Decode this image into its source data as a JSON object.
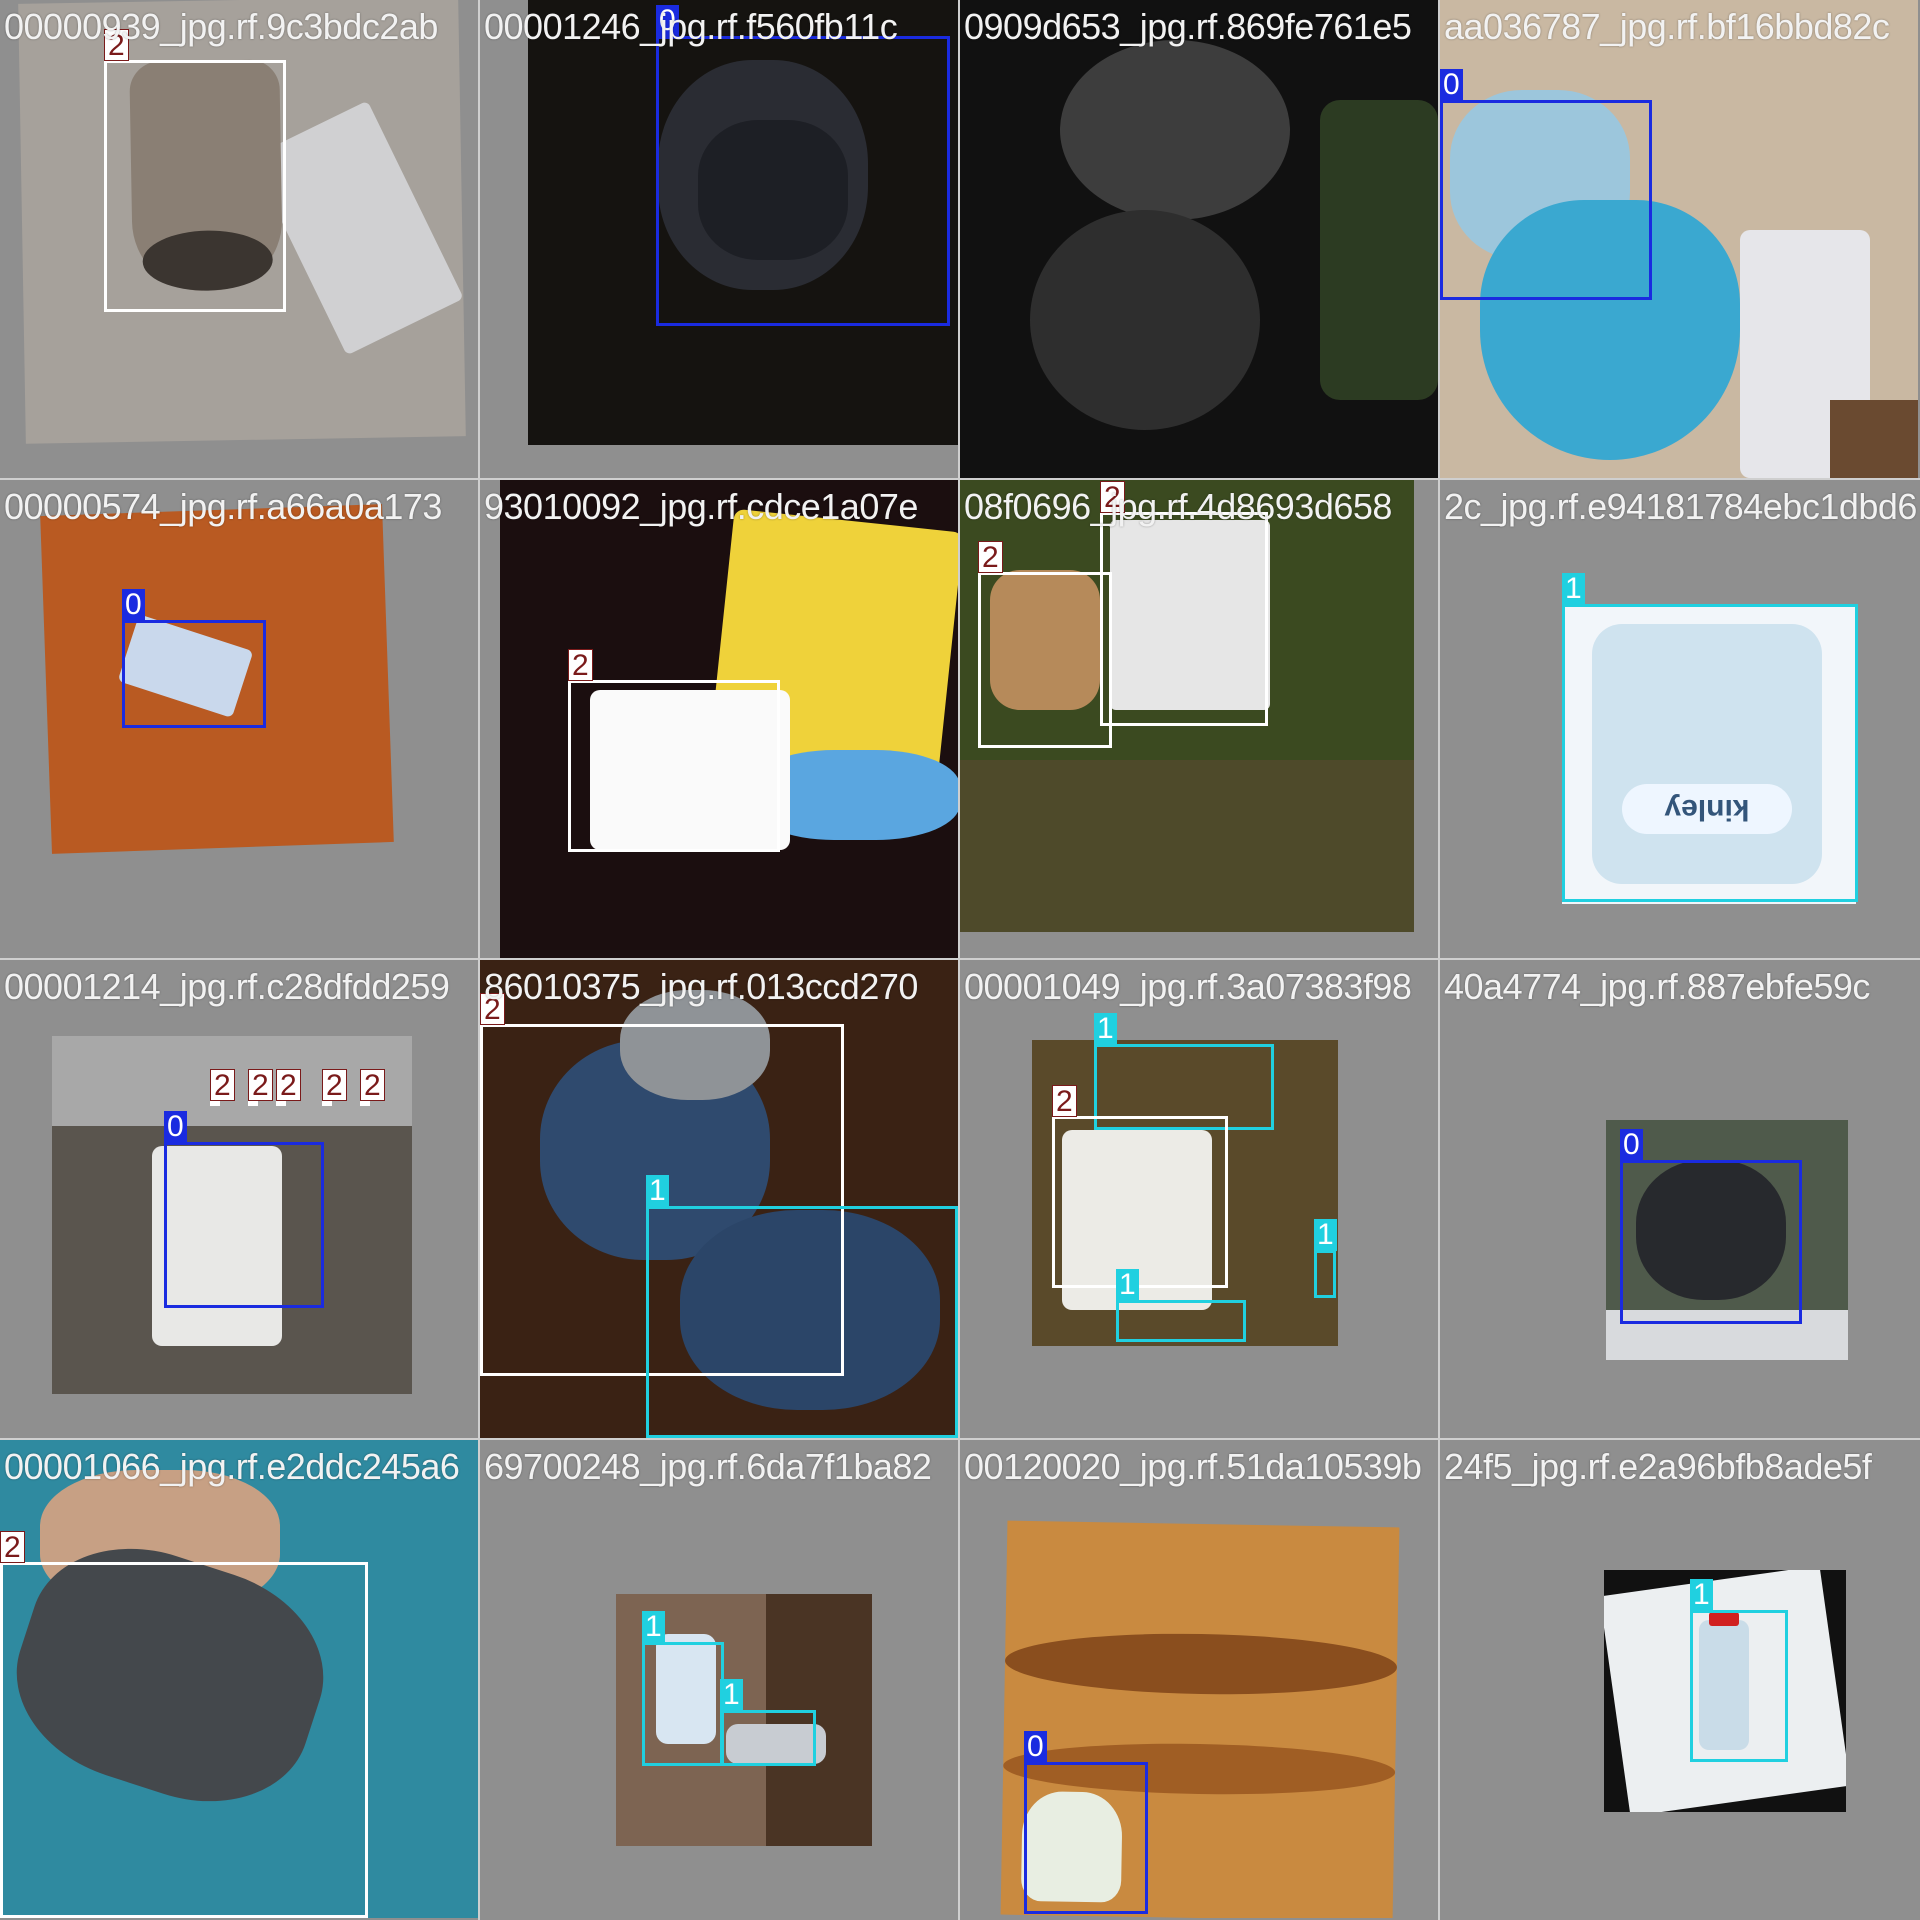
{
  "grid": {
    "tiles": [
      {
        "label": "00000939_jpg.rf.9c3bdc2ab",
        "boxes": [
          {
            "cls": "2"
          }
        ]
      },
      {
        "label": "00001246_jpg.rf.f560fb11c",
        "boxes": [
          {
            "cls": "0"
          }
        ]
      },
      {
        "label": "0909d653_jpg.rf.869fe761e5",
        "boxes": []
      },
      {
        "label": "aa036787_jpg.rf.bf16bbd82c",
        "boxes": [
          {
            "cls": "0"
          }
        ]
      },
      {
        "label": "00000574_jpg.rf.a66a0a173",
        "boxes": [
          {
            "cls": "0"
          }
        ]
      },
      {
        "label": "93010092_jpg.rf.cdce1a07e",
        "boxes": [
          {
            "cls": "2"
          }
        ]
      },
      {
        "label": "08f0696_jpg.rf.4d8693d658",
        "boxes": [
          {
            "cls": "2"
          },
          {
            "cls": "2"
          }
        ]
      },
      {
        "label": "2c_jpg.rf.e94181784ebc1dbd6",
        "boxes": [
          {
            "cls": "1"
          }
        ]
      },
      {
        "label": "00001214_jpg.rf.c28dfdd259",
        "boxes": [
          {
            "cls": "0"
          },
          {
            "cls": "2"
          },
          {
            "cls": "2"
          },
          {
            "cls": "2"
          },
          {
            "cls": "2"
          },
          {
            "cls": "2"
          }
        ]
      },
      {
        "label": "86010375_jpg.rf.013ccd270",
        "boxes": [
          {
            "cls": "2"
          },
          {
            "cls": "1"
          }
        ]
      },
      {
        "label": "00001049_jpg.rf.3a07383f98",
        "boxes": [
          {
            "cls": "1"
          },
          {
            "cls": "2"
          },
          {
            "cls": "1"
          },
          {
            "cls": "1"
          }
        ]
      },
      {
        "label": "40a4774_jpg.rf.887ebfe59c",
        "boxes": [
          {
            "cls": "0"
          }
        ]
      },
      {
        "label": "00001066_jpg.rf.e2ddc245a6",
        "boxes": [
          {
            "cls": "2"
          }
        ]
      },
      {
        "label": "69700248_jpg.rf.6da7f1ba82",
        "boxes": [
          {
            "cls": "1"
          },
          {
            "cls": "1"
          }
        ]
      },
      {
        "label": "00120020_jpg.rf.51da10539b",
        "boxes": [
          {
            "cls": "0"
          }
        ]
      },
      {
        "label": "24f5_jpg.rf.e2a96bfb8ade5f",
        "boxes": [
          {
            "cls": "1"
          }
        ]
      }
    ]
  },
  "photo_text": {
    "kinley": "kinley"
  },
  "colors": {
    "class_0": "#1a2be0",
    "class_1": "#20d0e0",
    "class_2": "#ffffff"
  }
}
